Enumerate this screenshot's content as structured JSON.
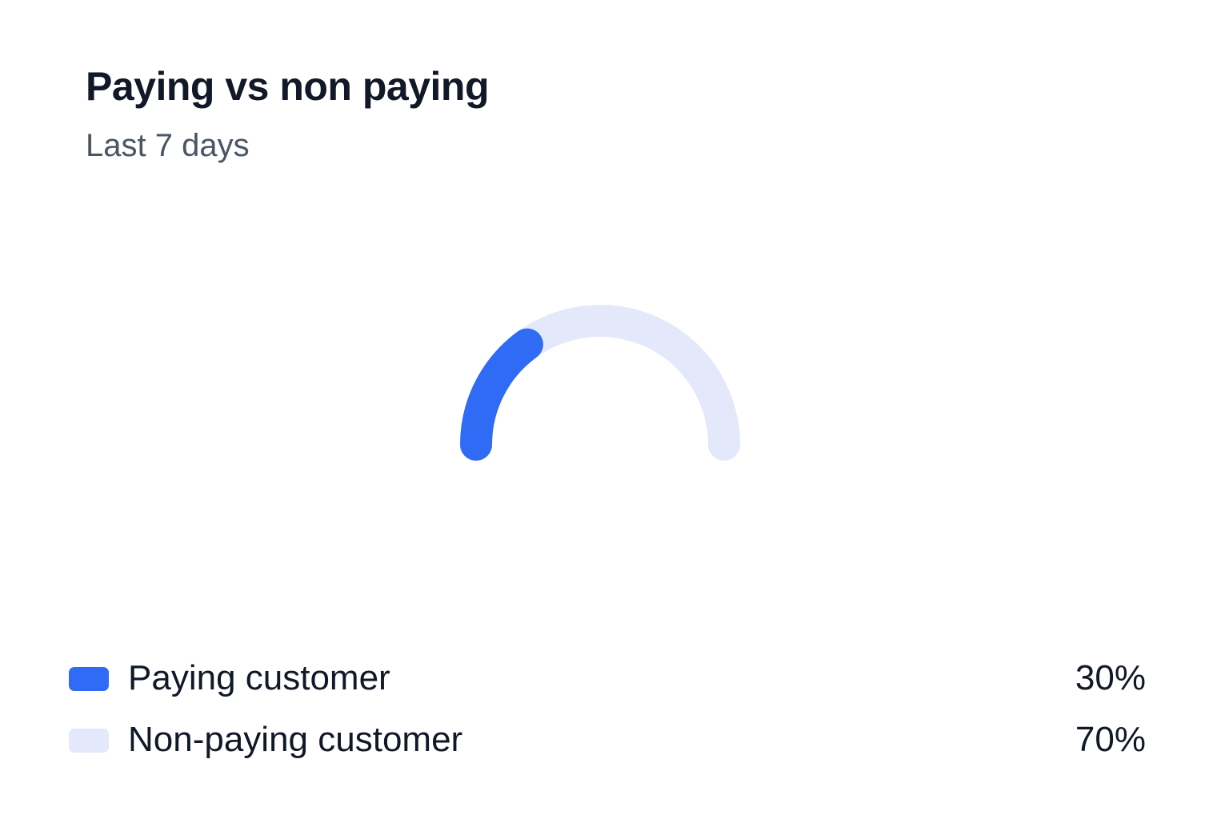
{
  "header": {
    "title": "Paying vs non paying",
    "subtitle": "Last 7 days"
  },
  "chart_data": {
    "type": "pie",
    "variant": "semi-donut gauge",
    "categories": [
      "Paying customer",
      "Non-paying customer"
    ],
    "values": [
      30,
      70
    ],
    "labels": [
      "30%",
      "70%"
    ],
    "colors": [
      "#2f6bf5",
      "#e4e8fb"
    ],
    "title": "Paying vs non paying",
    "subtitle": "Last 7 days",
    "legend_position": "bottom"
  },
  "legend": [
    {
      "label": "Paying customer",
      "value": "30%",
      "color": "#2f6bf5"
    },
    {
      "label": "Non-paying customer",
      "value": "70%",
      "color": "#e4e8fb"
    }
  ]
}
